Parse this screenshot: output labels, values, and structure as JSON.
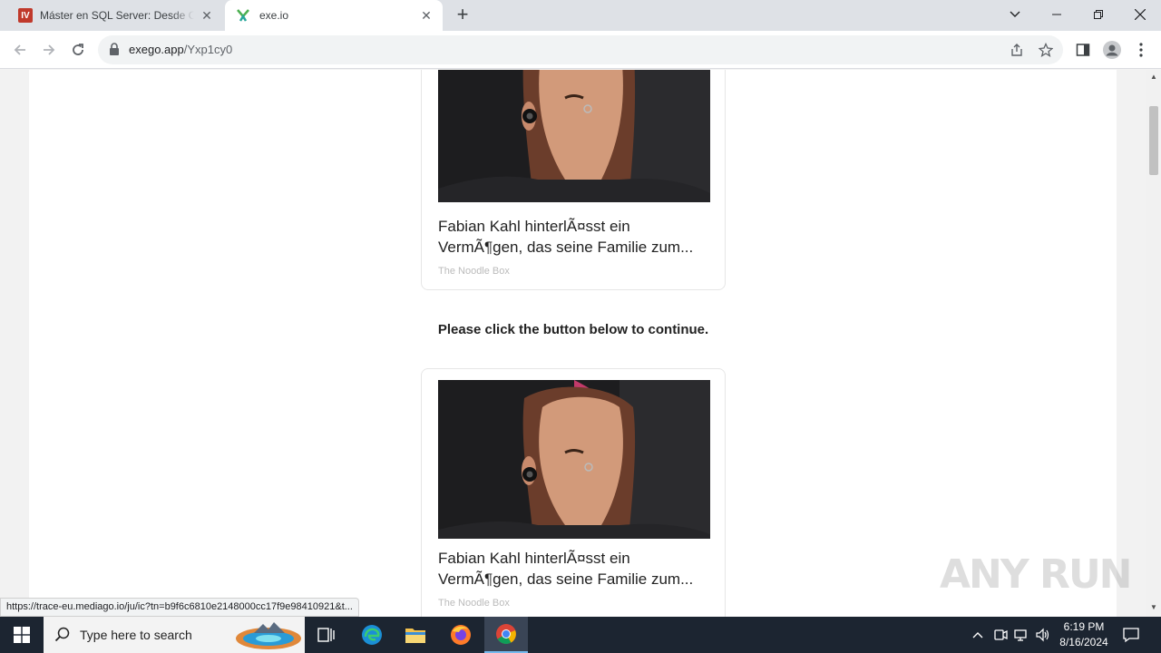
{
  "browser": {
    "tabs": [
      {
        "favicon": "iv-logo",
        "title": "Máster en SQL Server: Desde Cero"
      },
      {
        "favicon": "exe-logo",
        "title": "exe.io"
      }
    ],
    "url_host": "exego.app",
    "url_path": "/Yxp1cy0"
  },
  "page": {
    "cards": [
      {
        "title": "Fabian Kahl hinterlÃ¤sst ein VermÃ¶gen, das seine Familie zum...",
        "source": "The Noodle Box"
      },
      {
        "title": "Fabian Kahl hinterlÃ¤sst ein VermÃ¶gen, das seine Familie zum...",
        "source": "The Noodle Box"
      }
    ],
    "continue_message": "Please click the button below to continue."
  },
  "status_url": "https://trace-eu.mediago.io/ju/ic?tn=b9f6c6810e2148000cc17f9e98410921&t...",
  "watermark": "ANY RUN",
  "taskbar": {
    "search_placeholder": "Type here to search",
    "time": "6:19 PM",
    "date": "8/16/2024"
  },
  "colors": {
    "tab_strip": "#dee1e6",
    "taskbar": "#1c2531",
    "accent": "#1a73e8"
  }
}
